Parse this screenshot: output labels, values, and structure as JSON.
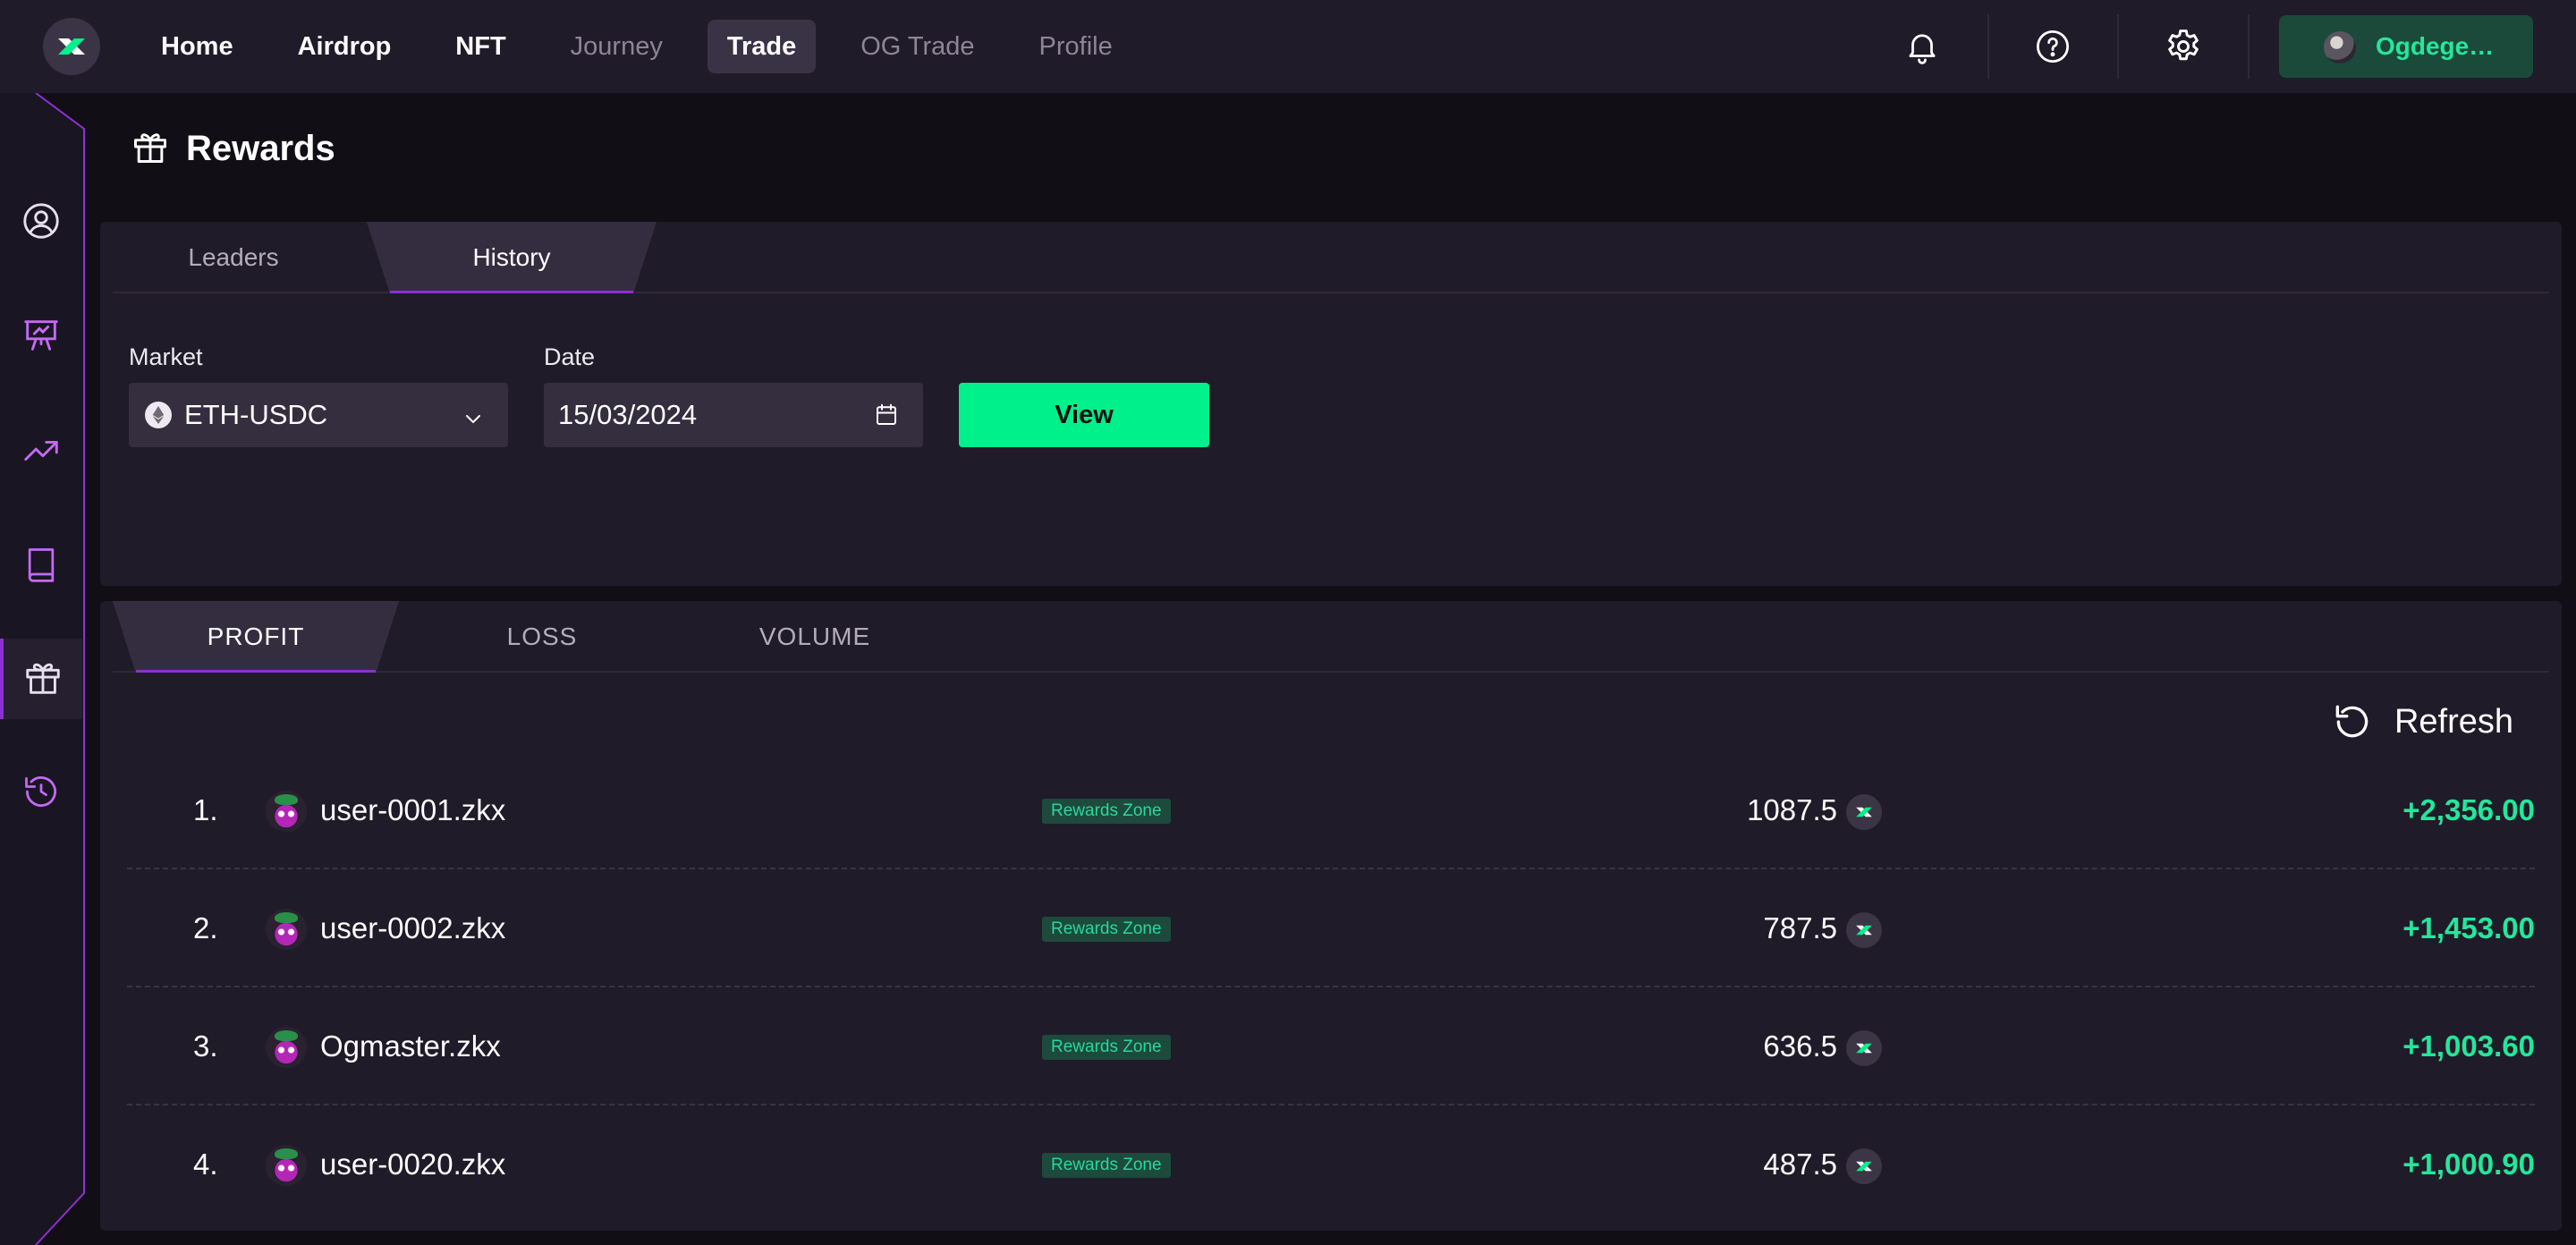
{
  "nav": {
    "items": [
      {
        "label": "Home",
        "state": "normal"
      },
      {
        "label": "Airdrop",
        "state": "normal"
      },
      {
        "label": "NFT",
        "state": "normal"
      },
      {
        "label": "Journey",
        "state": "dim"
      },
      {
        "label": "Trade",
        "state": "active"
      },
      {
        "label": "OG Trade",
        "state": "dim"
      },
      {
        "label": "Profile",
        "state": "dim"
      }
    ],
    "icons": [
      "bell-icon",
      "help-icon",
      "gear-icon"
    ],
    "user_label": "Ogdege…"
  },
  "sidebar": {
    "items": [
      {
        "icon": "profile-icon",
        "active": false
      },
      {
        "icon": "presentation-icon",
        "active": false
      },
      {
        "icon": "trending-up-icon",
        "active": false
      },
      {
        "icon": "book-icon",
        "active": false
      },
      {
        "icon": "gift-icon",
        "active": true
      },
      {
        "icon": "history-icon",
        "active": false
      }
    ]
  },
  "page": {
    "title": "Rewards"
  },
  "filters": {
    "tabs": [
      "Leaders",
      "History"
    ],
    "selected_tab": "History",
    "market_label": "Market",
    "market_value": "ETH-USDC",
    "date_label": "Date",
    "date_value": "15/03/2024",
    "view_button": "View"
  },
  "leaderboard": {
    "tabs": [
      "PROFIT",
      "LOSS",
      "VOLUME"
    ],
    "selected_tab": "PROFIT",
    "refresh_label": "Refresh",
    "rows": [
      {
        "rank": "1.",
        "name": "user-0001.zkx",
        "badge": "Rewards Zone",
        "points": "1087.5",
        "pnl": "+2,356.00"
      },
      {
        "rank": "2.",
        "name": "user-0002.zkx",
        "badge": "Rewards Zone",
        "points": "787.5",
        "pnl": "+1,453.00"
      },
      {
        "rank": "3.",
        "name": "Ogmaster.zkx",
        "badge": "Rewards Zone",
        "points": "636.5",
        "pnl": "+1,003.60"
      },
      {
        "rank": "4.",
        "name": "user-0020.zkx",
        "badge": "Rewards Zone",
        "points": "487.5",
        "pnl": "+1,000.90"
      }
    ]
  },
  "colors": {
    "accent_green": "#00f08c",
    "accent_purple": "#8e2fd4",
    "panel_bg": "#201b29",
    "page_bg": "#110e16"
  }
}
